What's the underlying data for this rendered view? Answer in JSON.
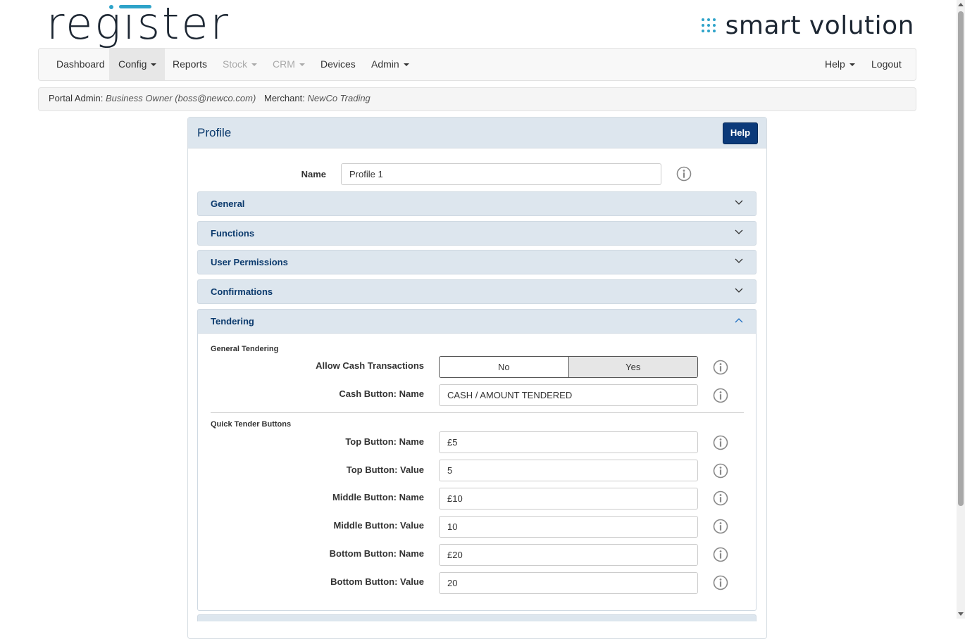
{
  "brand": {
    "left_logo": "register",
    "right_logo": "smart volution",
    "accent": "#2ea3c9"
  },
  "nav": {
    "left": [
      {
        "label": "Dashboard",
        "dropdown": false,
        "active": false,
        "disabled": false
      },
      {
        "label": "Config",
        "dropdown": true,
        "active": true,
        "disabled": false
      },
      {
        "label": "Reports",
        "dropdown": false,
        "active": false,
        "disabled": false
      },
      {
        "label": "Stock",
        "dropdown": true,
        "active": false,
        "disabled": true
      },
      {
        "label": "CRM",
        "dropdown": true,
        "active": false,
        "disabled": true
      },
      {
        "label": "Devices",
        "dropdown": false,
        "active": false,
        "disabled": false
      },
      {
        "label": "Admin",
        "dropdown": true,
        "active": false,
        "disabled": false
      }
    ],
    "right": [
      {
        "label": "Help",
        "dropdown": true
      },
      {
        "label": "Logout",
        "dropdown": false
      }
    ]
  },
  "info": {
    "portal_admin_label": "Portal Admin:",
    "portal_admin_value": "Business Owner (boss@newco.com)",
    "merchant_label": "Merchant:",
    "merchant_value": "NewCo Trading"
  },
  "panel": {
    "title": "Profile",
    "help_label": "Help",
    "name_label": "Name",
    "name_value": "Profile 1"
  },
  "accordions": [
    {
      "title": "General",
      "expanded": false
    },
    {
      "title": "Functions",
      "expanded": false
    },
    {
      "title": "User Permissions",
      "expanded": false
    },
    {
      "title": "Confirmations",
      "expanded": false
    },
    {
      "title": "Tendering",
      "expanded": true
    }
  ],
  "tendering": {
    "general_heading": "General Tendering",
    "allow_cash_label": "Allow Cash Transactions",
    "allow_cash_options": [
      "No",
      "Yes"
    ],
    "allow_cash_selected": "Yes",
    "cash_button_name_label": "Cash Button: Name",
    "cash_button_name_value": "CASH / AMOUNT TENDERED",
    "quick_heading": "Quick Tender Buttons",
    "fields": [
      {
        "label": "Top Button: Name",
        "value": "£5"
      },
      {
        "label": "Top Button: Value",
        "value": "5"
      },
      {
        "label": "Middle Button: Name",
        "value": "£10"
      },
      {
        "label": "Middle Button: Value",
        "value": "10"
      },
      {
        "label": "Bottom Button: Name",
        "value": "£20"
      },
      {
        "label": "Bottom Button: Value",
        "value": "20"
      }
    ]
  },
  "colors": {
    "primary": "#0b3a7a",
    "panel_header": "#dde6ee",
    "heading_text": "#0b3a6d"
  }
}
